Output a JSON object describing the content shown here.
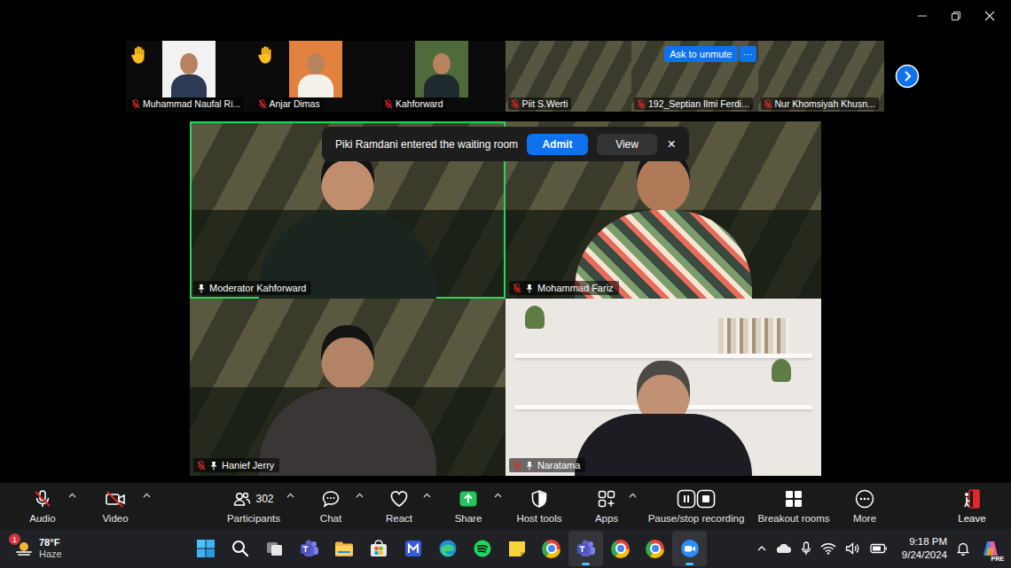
{
  "window": {
    "app": "Zoom Meeting"
  },
  "thumbnails": [
    {
      "name": "Muhammad Naufal Ri...",
      "muted": true,
      "hand_raised": true,
      "kind": "video",
      "hovered": false
    },
    {
      "name": "Anjar Dimas",
      "muted": true,
      "hand_raised": true,
      "kind": "video",
      "hovered": false
    },
    {
      "name": "Kahforward",
      "muted": true,
      "hand_raised": false,
      "kind": "video",
      "hovered": false
    },
    {
      "name": "Piit S.Werti",
      "muted": true,
      "hand_raised": false,
      "kind": "background",
      "hovered": false
    },
    {
      "name": "192_Septian Ilmi Ferdi...",
      "muted": true,
      "hand_raised": false,
      "kind": "background",
      "hovered": true
    },
    {
      "name": "Nur Khomsiyah Khusn...",
      "muted": true,
      "hand_raised": false,
      "kind": "background",
      "hovered": false
    }
  ],
  "thumbnail_actions": {
    "ask_to_unmute": "Ask to unmute",
    "more": "···"
  },
  "gallery": [
    {
      "name": "Moderator Kahforward",
      "muted": false,
      "pinned": true,
      "active_speaker": true,
      "kind": "background"
    },
    {
      "name": "Mohammad Fariz",
      "muted": true,
      "pinned": true,
      "active_speaker": false,
      "kind": "background"
    },
    {
      "name": "Hanief Jerry",
      "muted": true,
      "pinned": true,
      "active_speaker": false,
      "kind": "background"
    },
    {
      "name": "Naratama",
      "muted": true,
      "pinned": true,
      "active_speaker": false,
      "kind": "room"
    }
  ],
  "notification": {
    "text": "Piki Ramdani entered the waiting room",
    "admit": "Admit",
    "view": "View",
    "close": "×"
  },
  "toolbar": [
    {
      "label": "Audio",
      "kind": "audio",
      "off": true,
      "caret": true,
      "count": ""
    },
    {
      "label": "Video",
      "kind": "video",
      "off": true,
      "caret": true,
      "count": ""
    },
    {
      "label": "Participants",
      "kind": "participants",
      "off": false,
      "caret": true,
      "count": "302"
    },
    {
      "label": "Chat",
      "kind": "chat",
      "off": false,
      "caret": true,
      "count": ""
    },
    {
      "label": "React",
      "kind": "react",
      "off": false,
      "caret": true,
      "count": ""
    },
    {
      "label": "Share",
      "kind": "share",
      "off": false,
      "caret": true,
      "count": ""
    },
    {
      "label": "Host tools",
      "kind": "host",
      "off": false,
      "caret": false,
      "count": ""
    },
    {
      "label": "Apps",
      "kind": "apps",
      "off": false,
      "caret": true,
      "count": ""
    },
    {
      "label": "Pause/stop recording",
      "kind": "record",
      "off": false,
      "caret": false,
      "count": ""
    },
    {
      "label": "Breakout rooms",
      "kind": "breakout",
      "off": false,
      "caret": false,
      "count": ""
    },
    {
      "label": "More",
      "kind": "more",
      "off": false,
      "caret": false,
      "count": ""
    },
    {
      "label": "Leave",
      "kind": "leave",
      "off": false,
      "caret": false,
      "count": ""
    }
  ],
  "taskbar": {
    "weather": {
      "temp": "78°F",
      "condition": "Haze",
      "badge": "1"
    },
    "apps": [
      {
        "kind": "start",
        "active": false
      },
      {
        "kind": "search",
        "active": false
      },
      {
        "kind": "taskview",
        "active": false
      },
      {
        "kind": "teams",
        "active": false
      },
      {
        "kind": "explorer",
        "active": false
      },
      {
        "kind": "store",
        "active": false
      },
      {
        "kind": "todo",
        "active": false
      },
      {
        "kind": "edge",
        "active": false
      },
      {
        "kind": "spotify",
        "active": false
      },
      {
        "kind": "notes",
        "active": false
      },
      {
        "kind": "chrome",
        "active": false
      },
      {
        "kind": "teams",
        "active": true
      },
      {
        "kind": "chrome",
        "active": false
      },
      {
        "kind": "chrome",
        "active": false
      },
      {
        "kind": "zoom",
        "active": true
      }
    ],
    "clock": {
      "time": "9:18 PM",
      "date": "9/24/2024"
    },
    "copilot_badge": "PRE"
  }
}
